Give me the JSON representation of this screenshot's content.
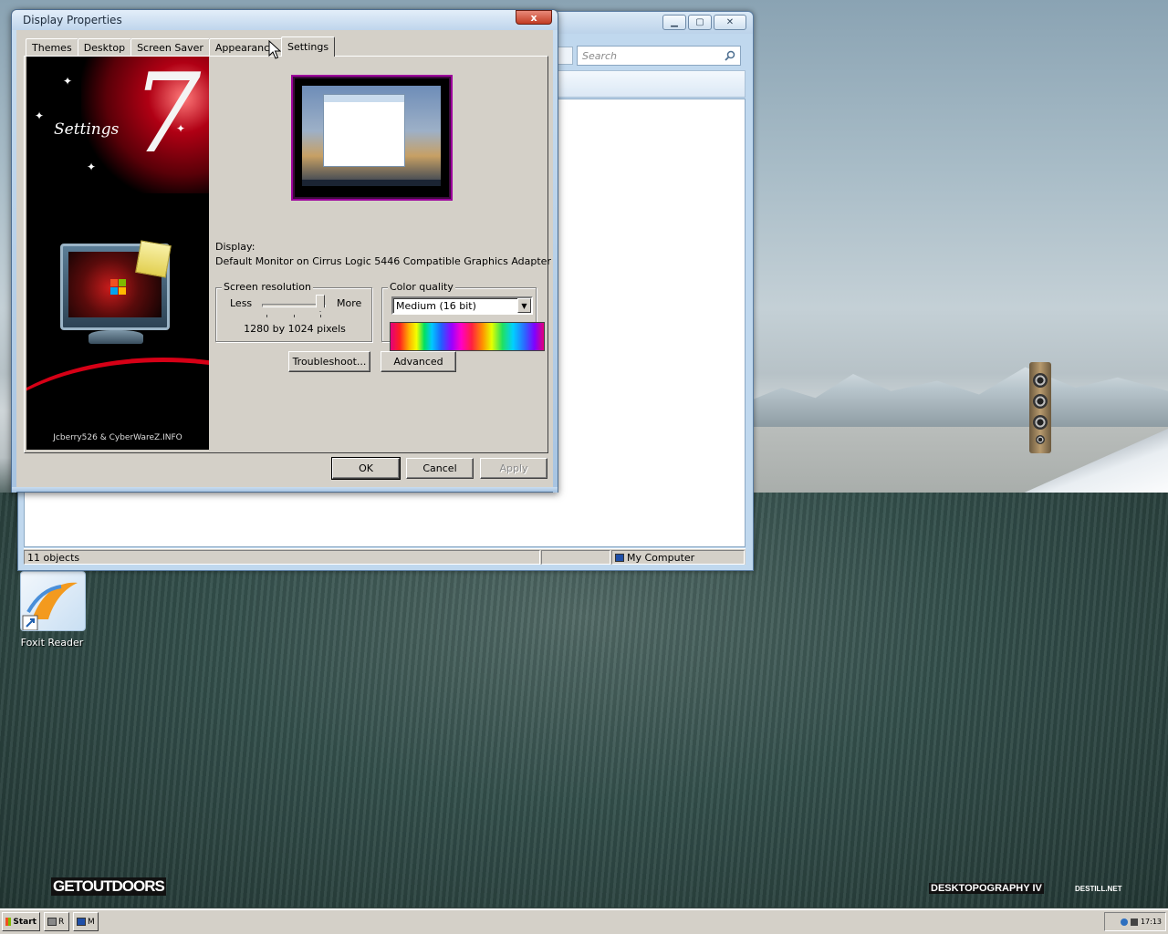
{
  "desktop": {
    "icons": [
      {
        "label": "Foxit Reader",
        "icon": "foxit-reader-icon"
      }
    ],
    "watermarks": {
      "left": "GETOUTDOORS",
      "center_right": "DESKTOPOGRAPHY IV",
      "right": "DESTILL.NET"
    }
  },
  "taskbar": {
    "start_label": "Start",
    "buttons": [
      {
        "label": "R",
        "icon": "explorer-icon"
      },
      {
        "label": "M",
        "icon": "display-icon"
      }
    ],
    "clock": "17:13"
  },
  "explorer": {
    "title": "",
    "search_placeholder": "Search",
    "status_objects": "11 objects",
    "status_location": "My Computer"
  },
  "dialog": {
    "title": "Display Properties",
    "close_label": "x",
    "tabs": [
      {
        "label": "Themes",
        "active": false
      },
      {
        "label": "Desktop",
        "active": false
      },
      {
        "label": "Screen Saver",
        "active": false
      },
      {
        "label": "Appearance",
        "active": false
      },
      {
        "label": "Settings",
        "active": true
      }
    ],
    "banner": {
      "title": "Settings",
      "numeral": "7",
      "credit": "Jcberry526 & CyberWareZ.INFO"
    },
    "display_label": "Display:",
    "display_device": "Default Monitor on Cirrus Logic 5446 Compatible Graphics Adapter",
    "resolution": {
      "group_title": "Screen resolution",
      "less_label": "Less",
      "more_label": "More",
      "value": "1280 by 1024 pixels",
      "slider_level": 0.9
    },
    "color_quality": {
      "group_title": "Color quality",
      "selected": "Medium (16 bit)"
    },
    "buttons": {
      "troubleshoot": "Troubleshoot...",
      "advanced": "Advanced",
      "ok": "OK",
      "cancel": "Cancel",
      "apply": "Apply"
    }
  },
  "colors": {
    "dialog_face": "#d4d0c8",
    "title_bar": "#bfd5ec",
    "close_button": "#c23c23",
    "banner_red": "#d60016"
  }
}
